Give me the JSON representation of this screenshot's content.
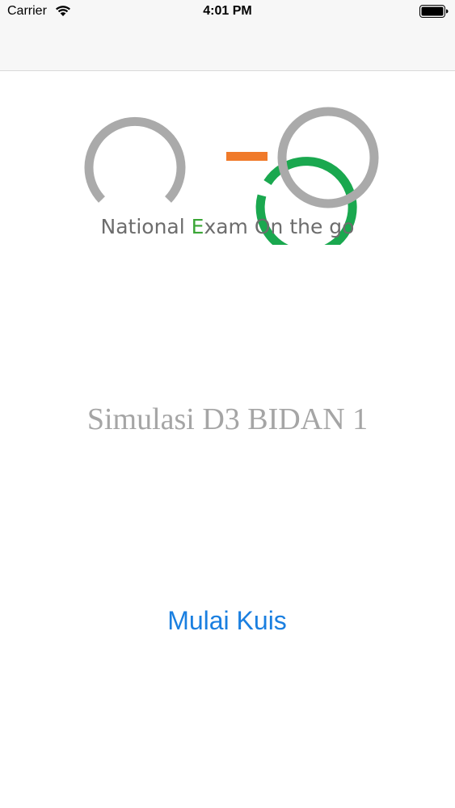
{
  "status_bar": {
    "carrier": "Carrier",
    "time": "4:01 PM",
    "wifi_icon": "wifi-icon",
    "battery_icon": "battery-full-icon"
  },
  "logo": {
    "mark": "neo",
    "tagline_prefix": "National ",
    "tagline_accent": "E",
    "tagline_suffix": "xam On the go",
    "colors": {
      "gray": "#aaaaaa",
      "green": "#1aa84f",
      "orange": "#f07a2a",
      "accent_text": "#3aa636"
    }
  },
  "main": {
    "title": "Simulasi D3 BIDAN 1",
    "start_button_label": "Mulai Kuis",
    "start_button_color": "#1a7fe0"
  }
}
